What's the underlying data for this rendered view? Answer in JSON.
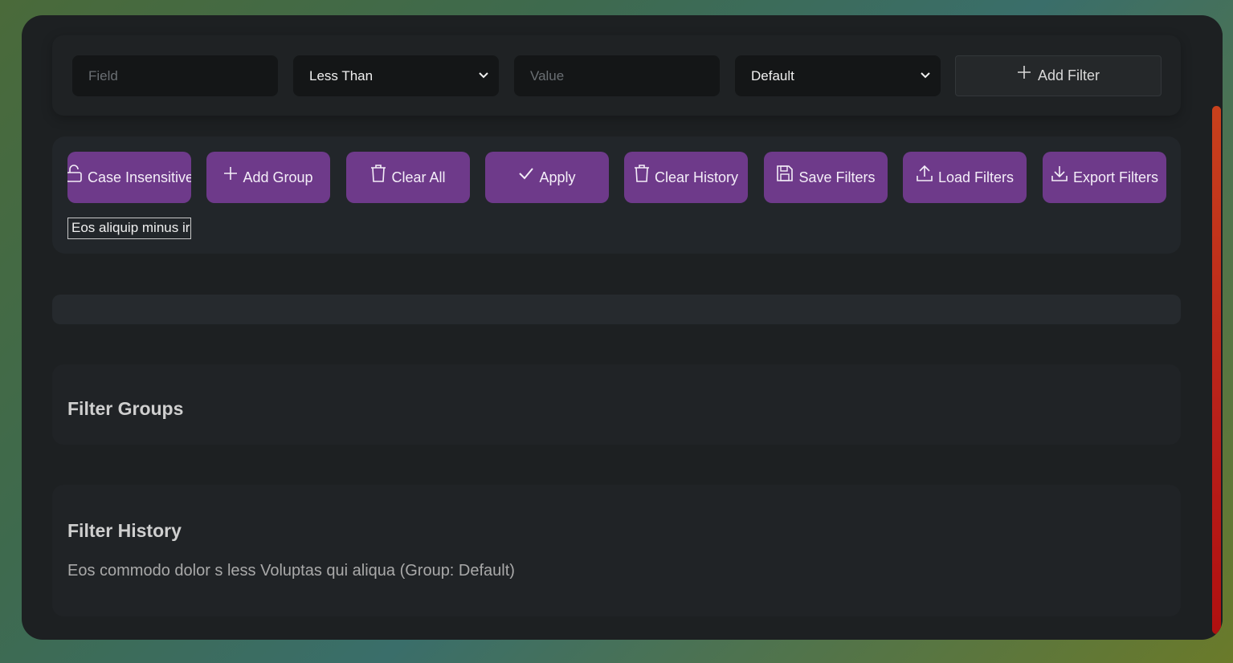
{
  "filter_row": {
    "field_placeholder": "Field",
    "operator_selected": "Less Than",
    "value_placeholder": "Value",
    "group_selected": "Default",
    "add_filter_label": "Add Filter"
  },
  "actions": [
    {
      "label": "Case Insensitive",
      "icon": "unlock-icon"
    },
    {
      "label": "Add Group",
      "icon": "plus-icon"
    },
    {
      "label": "Clear All",
      "icon": "trash-icon"
    },
    {
      "label": "Apply",
      "icon": "check-icon"
    },
    {
      "label": "Clear History",
      "icon": "trash-icon"
    },
    {
      "label": "Save Filters",
      "icon": "save-icon"
    },
    {
      "label": "Load Filters",
      "icon": "upload-icon"
    },
    {
      "label": "Export Filters",
      "icon": "download-icon"
    }
  ],
  "text_input_value": "Eos aliquip minus ir",
  "filter_groups": {
    "title": "Filter Groups"
  },
  "filter_history": {
    "title": "Filter History",
    "entries": [
      "Eos commodo dolor s less Voluptas qui aliqua (Group: Default)"
    ]
  },
  "colors": {
    "accent_purple": "#6e3a8a",
    "scrollbar": "#c8411c"
  }
}
